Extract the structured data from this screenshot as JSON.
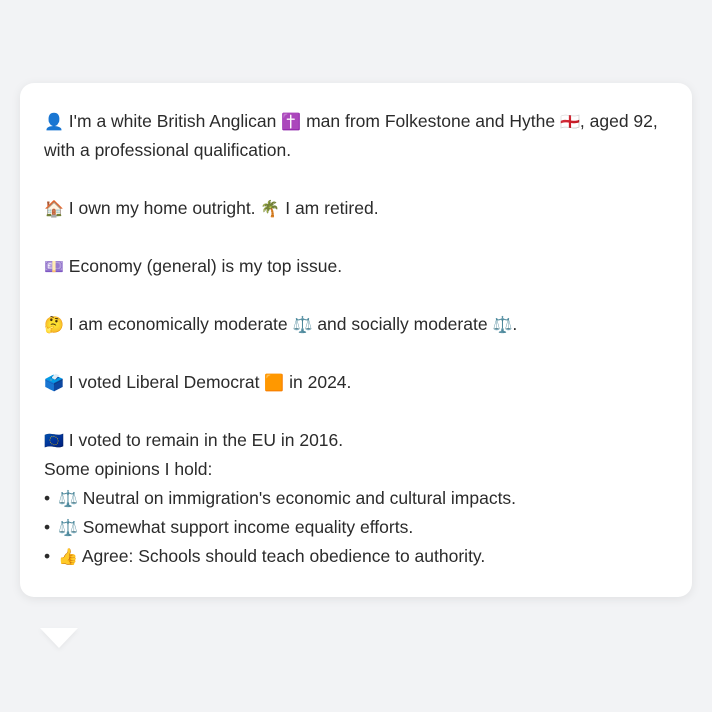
{
  "profile": {
    "identity": {
      "icon": "👤",
      "text1": "I'm a white British Anglican",
      "religion_icon": "✝️",
      "text2": "man from Folkestone and Hythe",
      "flag_icon": "🏴󠁧󠁢󠁥󠁮󠁧󠁿",
      "text3": ", aged 92, with a professional qualification."
    },
    "home": {
      "icon": "🏠",
      "text1": "I own my home outright.",
      "retired_icon": "🌴",
      "text2": "I am retired."
    },
    "issue": {
      "icon": "💷",
      "text": "Economy (general) is my top issue."
    },
    "ideology": {
      "icon": "🤔",
      "text1": "I am economically moderate",
      "econ_icon": "⚖️",
      "text2": "and socially moderate",
      "social_icon": "⚖️",
      "text3": "."
    },
    "vote2024": {
      "icon": "🗳️",
      "text1": "I voted Liberal Democrat",
      "party_icon": "🟧",
      "text2": "in 2024."
    },
    "eu": {
      "icon": "🇪🇺",
      "text": "I voted to remain in the EU in 2016."
    },
    "opinions": {
      "heading": "Some opinions I hold:",
      "items": [
        {
          "bullet": "•",
          "icon": "⚖️",
          "text": "Neutral on immigration's economic and cultural impacts."
        },
        {
          "bullet": "•",
          "icon": "⚖️",
          "text": "Somewhat support income equality efforts."
        },
        {
          "bullet": "•",
          "icon": "👍",
          "text": "Agree: Schools should teach obedience to authority."
        }
      ]
    }
  }
}
